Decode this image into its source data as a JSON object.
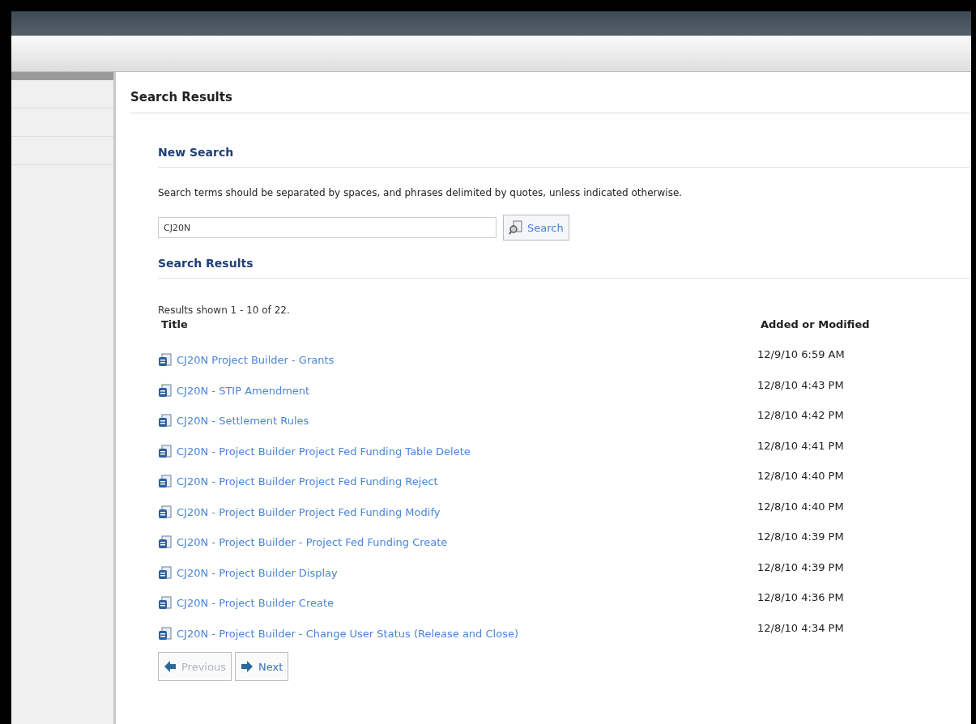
{
  "page_title": "Search Results",
  "new_search": {
    "heading": "New Search",
    "hint": "Search terms should be separated by spaces, and phrases delimited by quotes, unless indicated otherwise.",
    "query": "CJ20N",
    "button": "Search"
  },
  "results": {
    "heading": "Search Results",
    "summary": "Results shown 1 - 10 of 22.",
    "columns": [
      "Title",
      "Added or Modified"
    ],
    "rows": [
      {
        "title": "CJ20N Project Builder - Grants",
        "date": "12/9/10 6:59 AM"
      },
      {
        "title": "CJ20N - STIP Amendment",
        "date": "12/8/10 4:43 PM"
      },
      {
        "title": "CJ20N - Settlement Rules",
        "date": "12/8/10 4:42 PM"
      },
      {
        "title": "CJ20N - Project Builder Project Fed Funding Table Delete",
        "date": "12/8/10 4:41 PM"
      },
      {
        "title": "CJ20N - Project Builder Project Fed Funding Reject",
        "date": "12/8/10 4:40 PM"
      },
      {
        "title": "CJ20N - Project Builder Project Fed Funding Modify",
        "date": "12/8/10 4:40 PM"
      },
      {
        "title": "CJ20N - Project Builder - Project Fed Funding Create",
        "date": "12/8/10 4:39 PM"
      },
      {
        "title": "CJ20N - Project Builder Display",
        "date": "12/8/10 4:39 PM"
      },
      {
        "title": "CJ20N - Project Builder Create",
        "date": "12/8/10 4:36 PM"
      },
      {
        "title": "CJ20N - Project Builder - Change User Status (Release and Close)",
        "date": "12/8/10 4:34 PM"
      }
    ]
  },
  "pager": [
    {
      "kind": "previous",
      "label": "Previous",
      "disabled": true
    },
    {
      "kind": "next",
      "label": "Next",
      "disabled": false
    }
  ]
}
